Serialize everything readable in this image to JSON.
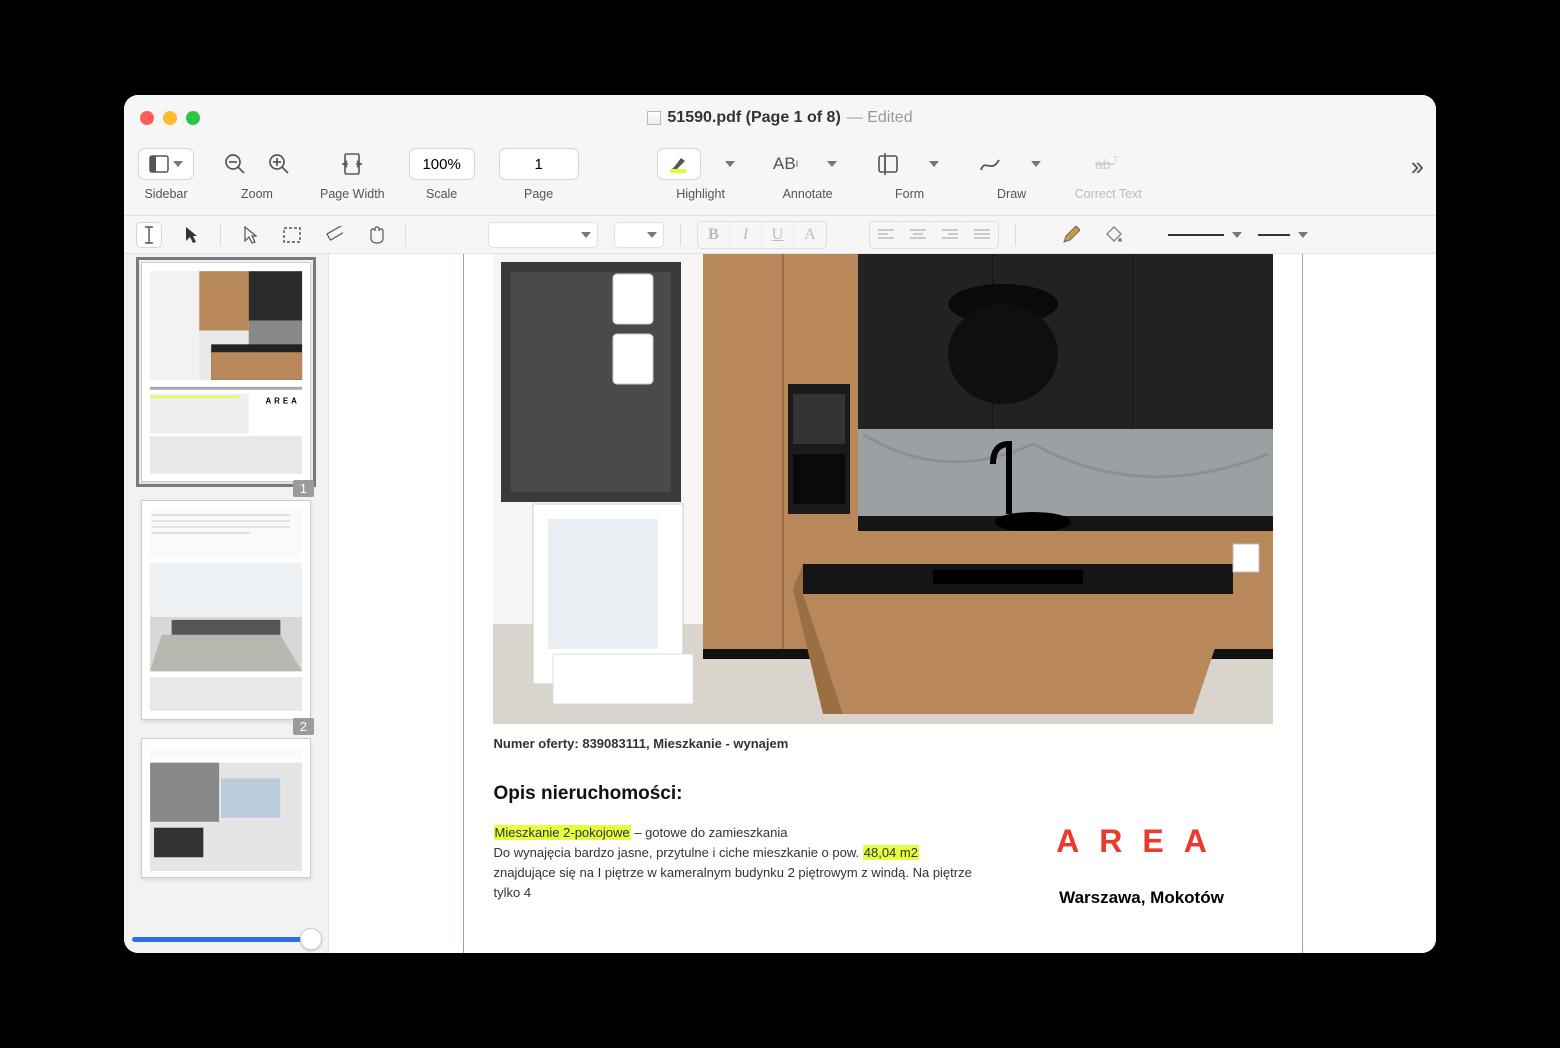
{
  "window": {
    "title_main": "51590.pdf (Page 1 of 8)",
    "title_suffix": " — Edited"
  },
  "toolbar": {
    "sidebar": "Sidebar",
    "zoom": "Zoom",
    "page_width": "Page Width",
    "scale": "Scale",
    "scale_value": "100%",
    "page": "Page",
    "page_value": "1",
    "highlight": "Highlight",
    "annotate": "Annotate",
    "form": "Form",
    "draw": "Draw",
    "correct_text": "Correct Text"
  },
  "thumbs": {
    "p1": "1",
    "p2": "2"
  },
  "doc": {
    "offer": "Numer oferty: 839083111, Mieszkanie - wynajem",
    "section_title": "Opis nieruchomości:",
    "hl1": "Mieszkanie 2-pokojowe",
    "txt1": " – gotowe do zamieszkania",
    "txt2": "Do wynajęcia bardzo jasne, przytulne i ciche mieszkanie o pow. ",
    "hl2": "48,04 m2",
    "txt3": " znajdujące się na I piętrze w kameralnym budynku 2 piętrowym z windą. Na piętrze tylko 4",
    "brand": "AREA",
    "location": "Warszawa, Mokotów"
  }
}
